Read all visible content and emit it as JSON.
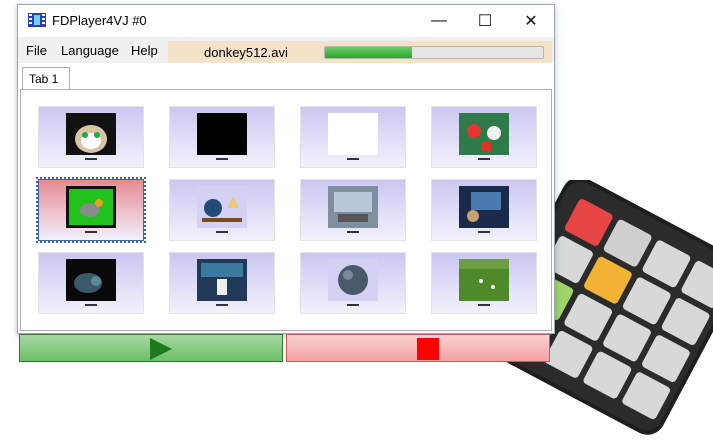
{
  "window": {
    "title": "FDPlayer4VJ #0",
    "controls": {
      "minimize": "—",
      "maximize": "☐",
      "close": "✕"
    }
  },
  "menu": {
    "file": "File",
    "language": "Language",
    "help": "Help"
  },
  "now_playing": {
    "filename": "donkey512.avi",
    "progress": 0.4
  },
  "tabs": [
    {
      "label": "Tab 1"
    }
  ],
  "thumbnails": [
    {
      "name": "cat",
      "bg": "#cbc7f2"
    },
    {
      "name": "black",
      "bg": "#cbc7f2"
    },
    {
      "name": "white",
      "bg": "#cbc7f2"
    },
    {
      "name": "dancers",
      "bg": "#cbc7f2"
    },
    {
      "name": "donkey-green",
      "bg": "#e58b94",
      "selected": true
    },
    {
      "name": "globe-desk",
      "bg": "#cbc7f2"
    },
    {
      "name": "studio",
      "bg": "#cbc7f2"
    },
    {
      "name": "presentation",
      "bg": "#cbc7f2"
    },
    {
      "name": "mouse-dark",
      "bg": "#cbc7f2"
    },
    {
      "name": "newsroom",
      "bg": "#cbc7f2"
    },
    {
      "name": "sphere",
      "bg": "#cbc7f2"
    },
    {
      "name": "soccer",
      "bg": "#cbc7f2"
    }
  ],
  "transport": {
    "play_color": "#1d7a1d",
    "stop_color": "#ff0000"
  }
}
